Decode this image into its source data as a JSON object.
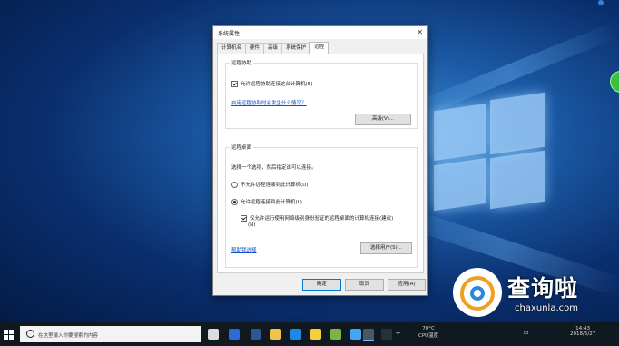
{
  "dialog": {
    "title": "系统属性",
    "close_label": "✕",
    "tabs": [
      {
        "label": "计算机名",
        "active": false
      },
      {
        "label": "硬件",
        "active": false
      },
      {
        "label": "高级",
        "active": false
      },
      {
        "label": "系统保护",
        "active": false
      },
      {
        "label": "远程",
        "active": true
      }
    ],
    "remote_assistance": {
      "group_label": "远程协助",
      "allow_checkbox_label": "允许远程协助连接这台计算机(R)",
      "allow_checked": true,
      "help_link": "启用远程协助时会发生什么情况？",
      "advanced_button": "高级(V)..."
    },
    "remote_desktop": {
      "group_label": "远程桌面",
      "instruction": "选择一个选项，然后指定谁可以连接。",
      "option_disallow": "不允许远程连接到此计算机(D)",
      "option_allow": "允许远程连接到此计算机(L)",
      "selected": "allow",
      "nla_checkbox_label": "仅允许运行使用网络级别身份验证的远程桌面的计算机连接(建议)",
      "nla_checkbox_suffix": "(N)",
      "nla_checked": true,
      "help_link": "帮助我选择",
      "select_users_button": "选择用户(S)..."
    },
    "buttons": {
      "ok": "确定",
      "cancel": "取消",
      "apply": "应用(A)"
    }
  },
  "taskbar": {
    "search_placeholder": "在这里输入你要搜索的内容",
    "temperature": "70°C",
    "cpu_label": "CPU温度",
    "ime": "中",
    "time": "14:43",
    "date": "2018/5/27"
  },
  "watermark": {
    "title": "查询啦",
    "subtitle": "chaxunla.com"
  },
  "colors": {
    "accent": "#0078d7",
    "link": "#0f4fc7",
    "taskbar": "#101820",
    "desktop": "#0a2f6e"
  }
}
